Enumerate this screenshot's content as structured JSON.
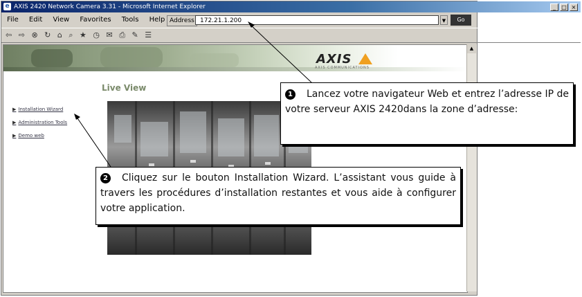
{
  "window": {
    "title": "AXIS 2420 Network Camera 3.31 - Microsoft Internet Explorer",
    "controls": [
      "_",
      "□",
      "×"
    ]
  },
  "menubar": {
    "items": [
      "File",
      "Edit",
      "View",
      "Favorites",
      "Tools",
      "Help"
    ]
  },
  "address": {
    "label": "Address",
    "value": "172.21.1.200",
    "go_label": "Go"
  },
  "toolbar": {
    "icons": [
      "back-icon",
      "forward-icon",
      "stop-icon",
      "refresh-icon",
      "home-icon",
      "search-icon",
      "favorites-icon",
      "history-icon",
      "mail-icon",
      "print-icon",
      "edit-icon",
      "discuss-icon"
    ]
  },
  "page": {
    "logo": "AXIS",
    "logo_tagline": "AXIS COMMUNICATIONS",
    "heading": "Live View",
    "nav": [
      {
        "label": "Installation Wizard"
      },
      {
        "label": "Administration Tools"
      },
      {
        "label": "Demo web"
      }
    ]
  },
  "callouts": {
    "c1": {
      "number": "1",
      "text": "Lancez votre navigateur Web et entrez l’adresse IP de votre serveur AXIS 2420dans la zone d’adresse:"
    },
    "c2": {
      "number": "2",
      "text": "Cliquez sur le bouton Installation Wizard. L’assistant vous guide à travers les procédures d’installation restantes et vous aide à configurer votre application."
    }
  },
  "colors": {
    "title_bar": "#0a246a",
    "heading": "#7a8a6a",
    "logo_accent": "#f0a020"
  }
}
